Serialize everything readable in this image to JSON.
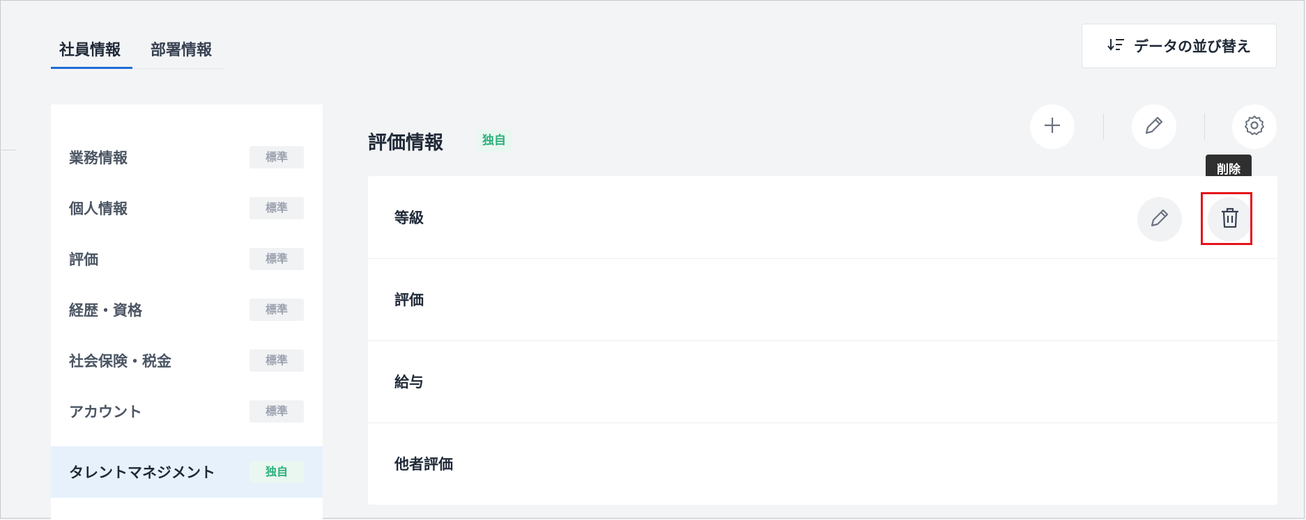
{
  "tabs": [
    {
      "label": "社員情報",
      "active": true
    },
    {
      "label": "部署情報",
      "active": false
    }
  ],
  "sort_button": {
    "label": "データの並び替え",
    "icon": "sort-icon"
  },
  "sidebar": {
    "items": [
      {
        "label": "業務情報",
        "badge": "標準"
      },
      {
        "label": "個人情報",
        "badge": "標準"
      },
      {
        "label": "評価",
        "badge": "標準"
      },
      {
        "label": "経歴・資格",
        "badge": "標準"
      },
      {
        "label": "社会保険・税金",
        "badge": "標準"
      },
      {
        "label": "アカウント",
        "badge": "標準"
      },
      {
        "label": "タレントマネジメント",
        "badge": "独自",
        "active": true
      }
    ]
  },
  "section": {
    "title": "評価情報",
    "badge": "独自",
    "actions": [
      "plus-icon",
      "pencil-icon",
      "gear-icon"
    ]
  },
  "tooltip": {
    "label": "削除"
  },
  "rows": [
    {
      "label": "等級",
      "actions": [
        "pencil-icon",
        "trash-icon"
      ]
    },
    {
      "label": "評価"
    },
    {
      "label": "給与"
    },
    {
      "label": "他者評価"
    }
  ],
  "colors": {
    "accent": "#1e6bd6",
    "custom_badge": "#2db07a",
    "highlight": "#e5131a"
  }
}
